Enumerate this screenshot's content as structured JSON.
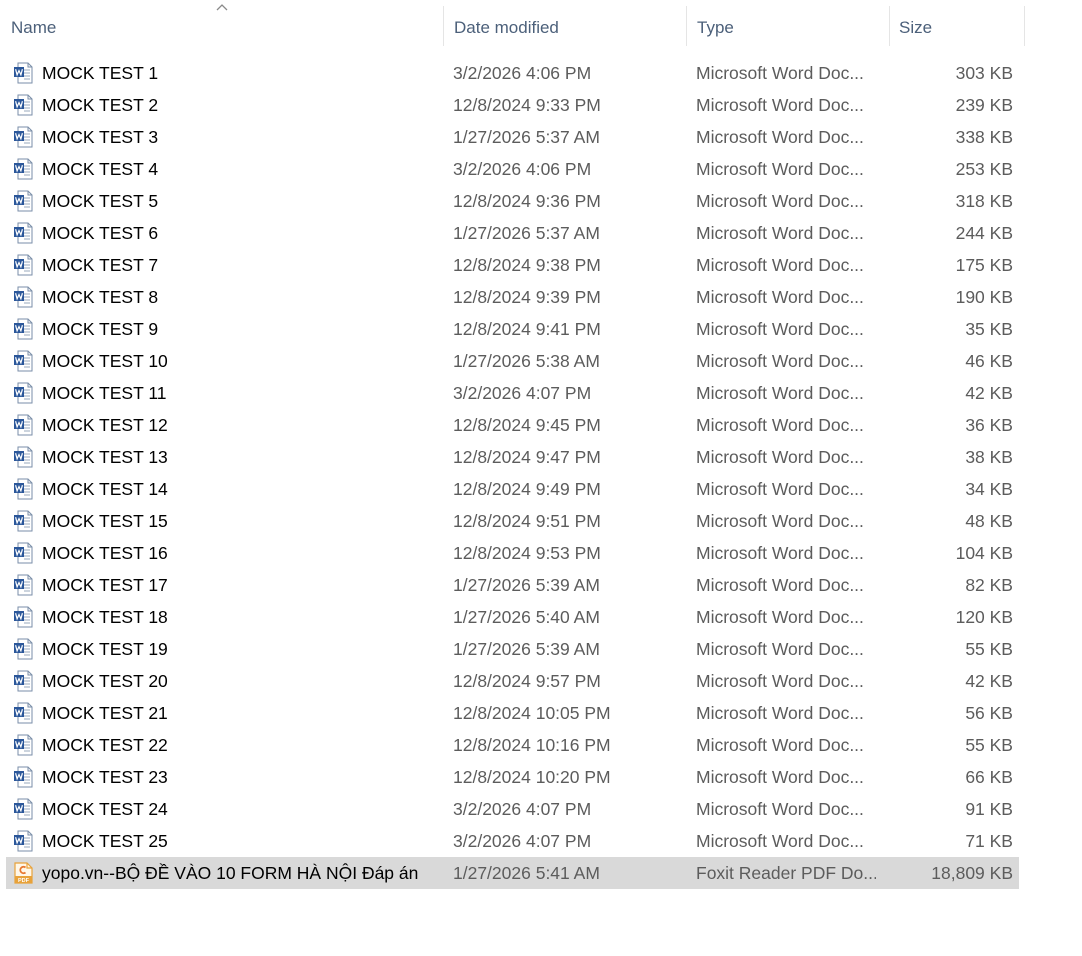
{
  "columns": {
    "name": "Name",
    "date": "Date modified",
    "type": "Type",
    "size": "Size"
  },
  "sort": {
    "column": "name",
    "direction": "ascending",
    "icon": "sort-caret-up-icon"
  },
  "colors": {
    "header_text": "#4c607a",
    "secondary_text": "#5c5c5c",
    "selected_row": "#d9d9d9",
    "word_icon": "#2b579a",
    "pdf_icon": "#e8a23a"
  },
  "files": [
    {
      "name": "MOCK TEST 1",
      "date": "3/2/2026 4:06 PM",
      "type": "Microsoft Word Doc...",
      "size": "303 KB",
      "icon": "word-doc-icon"
    },
    {
      "name": "MOCK TEST 2",
      "date": "12/8/2024 9:33 PM",
      "type": "Microsoft Word Doc...",
      "size": "239 KB",
      "icon": "word-doc-icon"
    },
    {
      "name": "MOCK TEST 3",
      "date": "1/27/2026 5:37 AM",
      "type": "Microsoft Word Doc...",
      "size": "338 KB",
      "icon": "word-doc-icon"
    },
    {
      "name": "MOCK TEST 4",
      "date": "3/2/2026 4:06 PM",
      "type": "Microsoft Word Doc...",
      "size": "253 KB",
      "icon": "word-doc-icon"
    },
    {
      "name": "MOCK TEST 5",
      "date": "12/8/2024 9:36 PM",
      "type": "Microsoft Word Doc...",
      "size": "318 KB",
      "icon": "word-doc-icon"
    },
    {
      "name": "MOCK TEST 6",
      "date": "1/27/2026 5:37 AM",
      "type": "Microsoft Word Doc...",
      "size": "244 KB",
      "icon": "word-doc-icon"
    },
    {
      "name": "MOCK TEST 7",
      "date": "12/8/2024 9:38 PM",
      "type": "Microsoft Word Doc...",
      "size": "175 KB",
      "icon": "word-doc-icon"
    },
    {
      "name": "MOCK TEST 8",
      "date": "12/8/2024 9:39 PM",
      "type": "Microsoft Word Doc...",
      "size": "190 KB",
      "icon": "word-doc-icon"
    },
    {
      "name": "MOCK TEST 9",
      "date": "12/8/2024 9:41 PM",
      "type": "Microsoft Word Doc...",
      "size": "35 KB",
      "icon": "word-doc-icon"
    },
    {
      "name": "MOCK TEST 10",
      "date": "1/27/2026 5:38 AM",
      "type": "Microsoft Word Doc...",
      "size": "46 KB",
      "icon": "word-doc-icon"
    },
    {
      "name": "MOCK TEST 11",
      "date": "3/2/2026 4:07 PM",
      "type": "Microsoft Word Doc...",
      "size": "42 KB",
      "icon": "word-doc-icon"
    },
    {
      "name": "MOCK TEST 12",
      "date": "12/8/2024 9:45 PM",
      "type": "Microsoft Word Doc...",
      "size": "36 KB",
      "icon": "word-doc-icon"
    },
    {
      "name": "MOCK TEST 13",
      "date": "12/8/2024 9:47 PM",
      "type": "Microsoft Word Doc...",
      "size": "38 KB",
      "icon": "word-doc-icon"
    },
    {
      "name": "MOCK TEST 14",
      "date": "12/8/2024 9:49 PM",
      "type": "Microsoft Word Doc...",
      "size": "34 KB",
      "icon": "word-doc-icon"
    },
    {
      "name": "MOCK TEST 15",
      "date": "12/8/2024 9:51 PM",
      "type": "Microsoft Word Doc...",
      "size": "48 KB",
      "icon": "word-doc-icon"
    },
    {
      "name": "MOCK TEST 16",
      "date": "12/8/2024 9:53 PM",
      "type": "Microsoft Word Doc...",
      "size": "104 KB",
      "icon": "word-doc-icon"
    },
    {
      "name": "MOCK TEST 17",
      "date": "1/27/2026 5:39 AM",
      "type": "Microsoft Word Doc...",
      "size": "82 KB",
      "icon": "word-doc-icon"
    },
    {
      "name": "MOCK TEST 18",
      "date": "1/27/2026 5:40 AM",
      "type": "Microsoft Word Doc...",
      "size": "120 KB",
      "icon": "word-doc-icon"
    },
    {
      "name": "MOCK TEST 19",
      "date": "1/27/2026 5:39 AM",
      "type": "Microsoft Word Doc...",
      "size": "55 KB",
      "icon": "word-doc-icon"
    },
    {
      "name": "MOCK TEST 20",
      "date": "12/8/2024 9:57 PM",
      "type": "Microsoft Word Doc...",
      "size": "42 KB",
      "icon": "word-doc-icon"
    },
    {
      "name": "MOCK TEST 21",
      "date": "12/8/2024 10:05 PM",
      "type": "Microsoft Word Doc...",
      "size": "56 KB",
      "icon": "word-doc-icon"
    },
    {
      "name": "MOCK TEST 22",
      "date": "12/8/2024 10:16 PM",
      "type": "Microsoft Word Doc...",
      "size": "55 KB",
      "icon": "word-doc-icon"
    },
    {
      "name": "MOCK TEST 23",
      "date": "12/8/2024 10:20 PM",
      "type": "Microsoft Word Doc...",
      "size": "66 KB",
      "icon": "word-doc-icon"
    },
    {
      "name": "MOCK TEST 24",
      "date": "3/2/2026 4:07 PM",
      "type": "Microsoft Word Doc...",
      "size": "91 KB",
      "icon": "word-doc-icon"
    },
    {
      "name": "MOCK TEST 25",
      "date": "3/2/2026 4:07 PM",
      "type": "Microsoft Word Doc...",
      "size": "71 KB",
      "icon": "word-doc-icon"
    },
    {
      "name": "yopo.vn--BỘ ĐỀ VÀO 10 FORM HÀ NỘI Đáp án",
      "date": "1/27/2026 5:41 AM",
      "type": "Foxit Reader PDF Do...",
      "size": "18,809 KB",
      "icon": "pdf-doc-icon",
      "selected": true
    }
  ]
}
